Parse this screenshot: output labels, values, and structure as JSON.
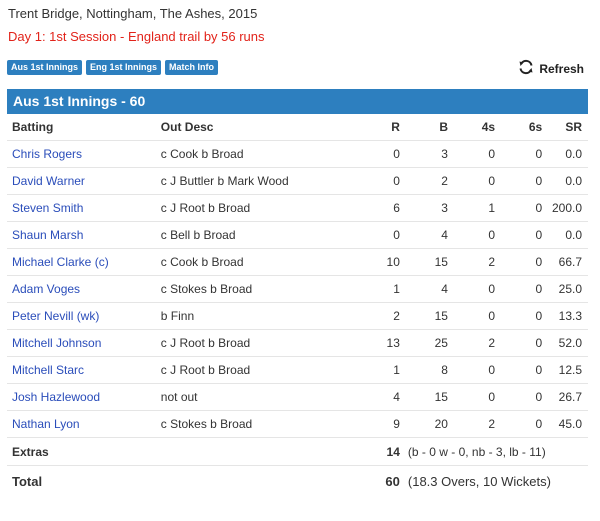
{
  "header": {
    "match_title": "Trent Bridge, Nottingham, The Ashes, 2015",
    "status": "Day 1: 1st Session - England trail by 56 runs"
  },
  "tabs": [
    {
      "label": "Aus 1st Innings"
    },
    {
      "label": "Eng 1st Innings"
    },
    {
      "label": "Match Info"
    }
  ],
  "refresh": {
    "label": "Refresh",
    "icon": "refresh-icon"
  },
  "innings": {
    "title": "Aus 1st Innings - 60",
    "columns": [
      "Batting",
      "Out Desc",
      "R",
      "B",
      "4s",
      "6s",
      "SR"
    ],
    "batters": [
      {
        "name": "Chris Rogers",
        "out": "c Cook b Broad",
        "r": "0",
        "b": "3",
        "fours": "0",
        "sixes": "0",
        "sr": "0.0"
      },
      {
        "name": "David Warner",
        "out": "c J Buttler b Mark Wood",
        "r": "0",
        "b": "2",
        "fours": "0",
        "sixes": "0",
        "sr": "0.0"
      },
      {
        "name": "Steven Smith",
        "out": "c J Root b Broad",
        "r": "6",
        "b": "3",
        "fours": "1",
        "sixes": "0",
        "sr": "200.0"
      },
      {
        "name": "Shaun Marsh",
        "out": "c Bell b Broad",
        "r": "0",
        "b": "4",
        "fours": "0",
        "sixes": "0",
        "sr": "0.0"
      },
      {
        "name": "Michael Clarke (c)",
        "out": "c Cook b Broad",
        "r": "10",
        "b": "15",
        "fours": "2",
        "sixes": "0",
        "sr": "66.7"
      },
      {
        "name": "Adam Voges",
        "out": "c Stokes b Broad",
        "r": "1",
        "b": "4",
        "fours": "0",
        "sixes": "0",
        "sr": "25.0"
      },
      {
        "name": "Peter Nevill (wk)",
        "out": "b Finn",
        "r": "2",
        "b": "15",
        "fours": "0",
        "sixes": "0",
        "sr": "13.3"
      },
      {
        "name": "Mitchell Johnson",
        "out": "c J Root b Broad",
        "r": "13",
        "b": "25",
        "fours": "2",
        "sixes": "0",
        "sr": "52.0"
      },
      {
        "name": "Mitchell Starc",
        "out": "c J Root b Broad",
        "r": "1",
        "b": "8",
        "fours": "0",
        "sixes": "0",
        "sr": "12.5"
      },
      {
        "name": "Josh Hazlewood",
        "out": "not out",
        "r": "4",
        "b": "15",
        "fours": "0",
        "sixes": "0",
        "sr": "26.7"
      },
      {
        "name": "Nathan Lyon",
        "out": "c Stokes b Broad",
        "r": "9",
        "b": "20",
        "fours": "2",
        "sixes": "0",
        "sr": "45.0"
      }
    ],
    "extras": {
      "label": "Extras",
      "value": "14",
      "detail": "(b - 0 w - 0, nb - 3, lb - 11)"
    },
    "total": {
      "label": "Total",
      "value": "60",
      "detail": "(18.3 Overs, 10 Wickets)"
    }
  },
  "colors": {
    "accent": "#2d7fbf",
    "status": "#e2231a",
    "link": "#2a4dba"
  }
}
